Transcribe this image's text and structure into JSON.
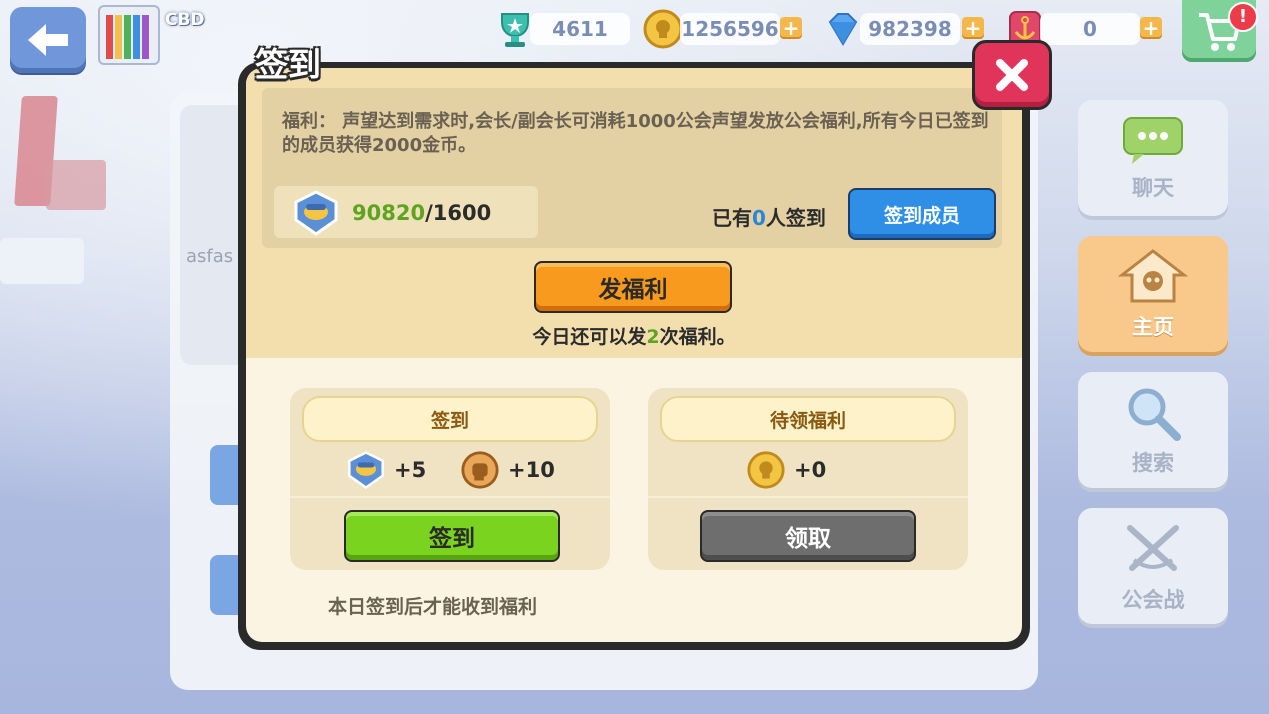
{
  "top_bar": {
    "guild_name": "CBD",
    "trophies": "4611",
    "gold": "1256596",
    "diamonds": "982398",
    "anchors": "0",
    "cart_badge": "!"
  },
  "side_nav": {
    "chat": "聊天",
    "home": "主页",
    "search": "搜索",
    "guild_war": "公会战"
  },
  "underlay": {
    "input_text": "asfas"
  },
  "dialog": {
    "title": "签到",
    "info": "福利：  声望达到需求时,会长/副会长可消耗1000公会声望发放公会福利,所有今日已签到的成员获得2000金币。",
    "reputation_current": "90820",
    "reputation_sep_required": "/1600",
    "signed_prefix": "已有",
    "signed_count": "0",
    "signed_suffix": "人签到",
    "members_button": "签到成员",
    "welfare_button": "发福利",
    "welfare_note_prefix": "今日还可以发",
    "welfare_note_count": "2",
    "welfare_note_suffix": "次福利。",
    "signin_card": {
      "title": "签到",
      "reward1": "+5",
      "reward2": "+10",
      "button": "签到"
    },
    "pending_card": {
      "title": "待领福利",
      "reward": "+0",
      "button": "领取"
    },
    "footer_note": "本日签到后才能收到福利"
  },
  "colors": {
    "accent_green": "#5ea420",
    "accent_blue": "#2b86d8",
    "close_red": "#e0345a",
    "welfare_orange": "#f79a1e"
  }
}
